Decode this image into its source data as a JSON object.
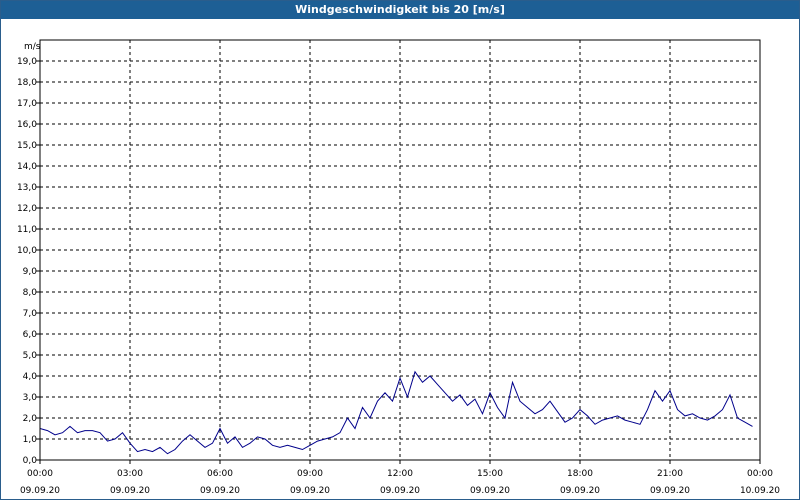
{
  "window": {
    "title": "Windgeschwindigkeit bis 20 [m/s]"
  },
  "chart_data": {
    "type": "line",
    "title": "Windgeschwindigkeit bis 20 [m/s]",
    "ylabel": "m/s",
    "ylim": [
      0,
      20
    ],
    "xlim_hours": [
      0,
      24
    ],
    "grid": true,
    "y_ticks": [
      "0,0",
      "1,0",
      "2,0",
      "3,0",
      "4,0",
      "5,0",
      "6,0",
      "7,0",
      "8,0",
      "9,0",
      "10,0",
      "11,0",
      "12,0",
      "13,0",
      "14,0",
      "15,0",
      "16,0",
      "17,0",
      "18,0",
      "19,0"
    ],
    "x_ticks": [
      {
        "time": "00:00",
        "date": "09.09.20"
      },
      {
        "time": "03:00",
        "date": "09.09.20"
      },
      {
        "time": "06:00",
        "date": "09.09.20"
      },
      {
        "time": "09:00",
        "date": "09.09.20"
      },
      {
        "time": "12:00",
        "date": "09.09.20"
      },
      {
        "time": "15:00",
        "date": "09.09.20"
      },
      {
        "time": "18:00",
        "date": "09.09.20"
      },
      {
        "time": "21:00",
        "date": "09.09.20"
      },
      {
        "time": "00:00",
        "date": "10.09.20"
      }
    ],
    "series": [
      {
        "color": "#00008b",
        "x": [
          0.0,
          0.25,
          0.5,
          0.75,
          1.0,
          1.25,
          1.5,
          1.75,
          2.0,
          2.25,
          2.5,
          2.75,
          3.0,
          3.25,
          3.5,
          3.75,
          4.0,
          4.25,
          4.5,
          4.75,
          5.0,
          5.25,
          5.5,
          5.75,
          6.0,
          6.25,
          6.5,
          6.75,
          7.0,
          7.25,
          7.5,
          7.75,
          8.0,
          8.25,
          8.5,
          8.75,
          9.0,
          9.25,
          9.5,
          9.75,
          10.0,
          10.25,
          10.5,
          10.75,
          11.0,
          11.25,
          11.5,
          11.75,
          12.0,
          12.25,
          12.5,
          12.75,
          13.0,
          13.25,
          13.5,
          13.75,
          14.0,
          14.25,
          14.5,
          14.75,
          15.0,
          15.25,
          15.5,
          15.75,
          16.0,
          16.25,
          16.5,
          16.75,
          17.0,
          17.25,
          17.5,
          17.75,
          18.0,
          18.25,
          18.5,
          18.75,
          19.0,
          19.25,
          19.5,
          19.75,
          20.0,
          20.25,
          20.5,
          20.75,
          21.0,
          21.25,
          21.5,
          21.75,
          22.0,
          22.25,
          22.5,
          22.75,
          23.0,
          23.25,
          23.5,
          23.75
        ],
        "values": [
          1.5,
          1.4,
          1.2,
          1.3,
          1.6,
          1.3,
          1.4,
          1.4,
          1.3,
          0.9,
          1.0,
          1.3,
          0.8,
          0.4,
          0.5,
          0.4,
          0.6,
          0.3,
          0.5,
          0.9,
          1.2,
          0.9,
          0.6,
          0.8,
          1.5,
          0.8,
          1.1,
          0.6,
          0.8,
          1.1,
          1.0,
          0.7,
          0.6,
          0.7,
          0.6,
          0.5,
          0.7,
          0.9,
          1.0,
          1.1,
          1.3,
          2.0,
          1.5,
          2.5,
          2.0,
          2.8,
          3.2,
          2.8,
          3.9,
          3.0,
          4.2,
          3.7,
          4.0,
          3.6,
          3.2,
          2.8,
          3.1,
          2.6,
          2.9,
          2.2,
          3.2,
          2.5,
          2.0,
          3.7,
          2.8,
          2.5,
          2.2,
          2.4,
          2.8,
          2.3,
          1.8,
          2.0,
          2.4,
          2.1,
          1.7,
          1.9,
          2.0,
          2.1,
          1.9,
          1.8,
          1.7,
          2.4,
          3.3,
          2.8,
          3.3,
          2.4,
          2.1,
          2.2,
          2.0,
          1.9,
          2.1,
          2.4,
          3.1,
          2.0,
          1.8,
          1.6
        ]
      }
    ]
  }
}
